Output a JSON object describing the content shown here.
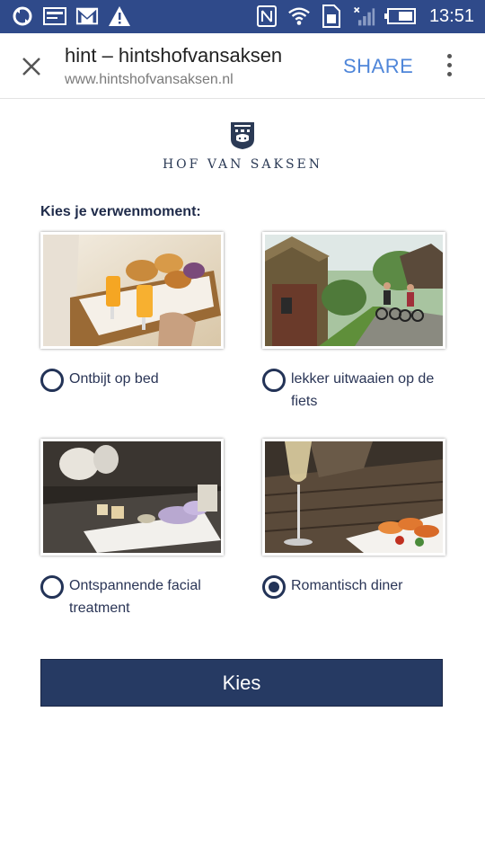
{
  "status_bar": {
    "time": "13:51",
    "icons": [
      "sync-icon",
      "card-icon",
      "gmail-icon",
      "warning-icon",
      "nfc-icon",
      "wifi-icon",
      "sim-icon",
      "signal-icon",
      "battery-icon"
    ]
  },
  "toolbar": {
    "title": "hint – hintshofvansaksen",
    "url": "www.hintshofvansaksen.nl",
    "share_label": "SHARE"
  },
  "logo": {
    "text": "HOF VAN SAKSEN"
  },
  "form": {
    "prompt": "Kies je verwenmoment:",
    "options": [
      {
        "label": "Ontbijt op bed",
        "selected": false,
        "image": "breakfast-tray-photo"
      },
      {
        "label": "lekker uitwaaien op de fiets",
        "selected": false,
        "image": "cycling-photo"
      },
      {
        "label": "Ontspannende facial treatment",
        "selected": false,
        "image": "spa-photo"
      },
      {
        "label": "Romantisch diner",
        "selected": true,
        "image": "dinner-photo"
      }
    ],
    "submit_label": "Kies"
  },
  "colors": {
    "status_bar": "#2f4a8a",
    "accent": "#263a63",
    "share": "#4f86d9"
  }
}
